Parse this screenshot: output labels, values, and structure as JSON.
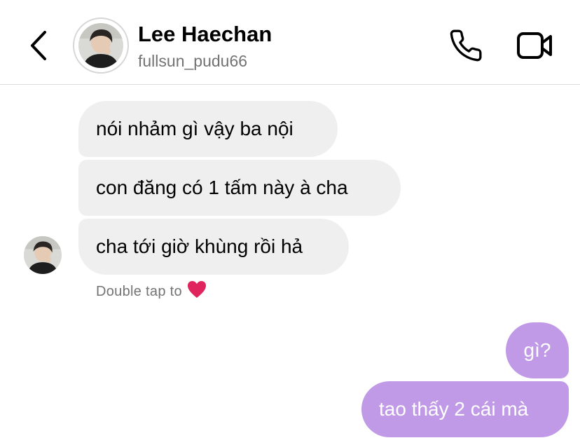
{
  "header": {
    "name": "Lee Haechan",
    "username": "fullsun_pudu66",
    "back_icon": "chevron-left-icon",
    "call_icon": "phone-icon",
    "video_icon": "video-camera-icon"
  },
  "messages": [
    {
      "direction": "received",
      "text": "nói nhảm gì vậy ba nội"
    },
    {
      "direction": "received",
      "text": "con đăng có 1 tấm này à cha"
    },
    {
      "direction": "received",
      "text": "cha tới giờ khùng rồi hả"
    },
    {
      "direction": "sent",
      "text": "gì?"
    },
    {
      "direction": "sent",
      "text": "tao thấy 2 cái mà"
    }
  ],
  "hint": {
    "text": "Double tap to",
    "icon": "heart-icon"
  },
  "colors": {
    "sent_bubble": "#c09ae6",
    "received_bubble": "#efefef",
    "secondary_text": "#737373",
    "heart": "#e0245e"
  }
}
